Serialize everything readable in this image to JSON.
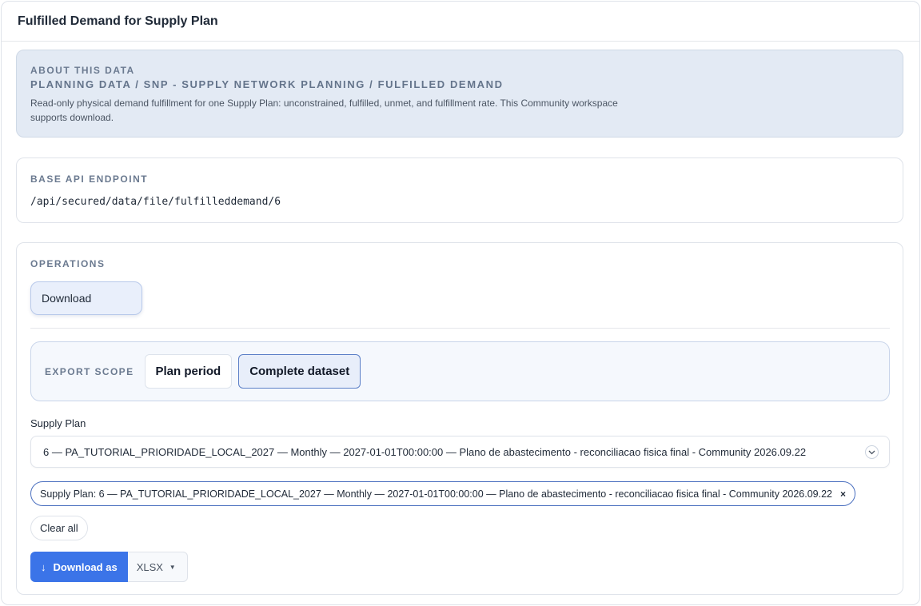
{
  "panel": {
    "title": "Fulfilled Demand for Supply Plan"
  },
  "about": {
    "eyebrow": "ABOUT THIS DATA",
    "path": "PLANNING DATA / SNP - SUPPLY NETWORK PLANNING / FULFILLED DEMAND",
    "description": "Read-only physical demand fulfillment for one Supply Plan: unconstrained, fulfilled, unmet, and fulfillment rate. This Community workspace supports download."
  },
  "endpoint": {
    "label": "BASE API ENDPOINT",
    "value": "/api/secured/data/file/fulfilleddemand/6"
  },
  "operations": {
    "label": "OPERATIONS",
    "tabs": [
      {
        "label": "Download",
        "active": true
      }
    ],
    "export_scope": {
      "label": "EXPORT SCOPE",
      "options": [
        "Plan period",
        "Complete dataset"
      ],
      "selected": "Complete dataset"
    },
    "supply_plan": {
      "label": "Supply Plan",
      "value": "6 — PA_TUTORIAL_PRIORIDADE_LOCAL_2027 — Monthly — 2027-01-01T00:00:00 — Plano de abastecimento - reconciliacao fisica final - Community 2026.09.22"
    },
    "chip": "Supply Plan: 6 — PA_TUTORIAL_PRIORIDADE_LOCAL_2027 — Monthly — 2027-01-01T00:00:00 — Plano de abastecimento - reconciliacao fisica final - Community 2026.09.22",
    "clear_all": "Clear all",
    "download_button": "Download as",
    "format": "XLSX"
  },
  "icons": {
    "chevron": "chevron-down-icon",
    "chip_close": "close-icon",
    "download": "arrow-down-icon",
    "format_caret": "caret-down-icon"
  },
  "colors": {
    "accent": "#3b74e8",
    "about_bg": "#e3eaf4",
    "active_border": "#5b7fc7"
  }
}
